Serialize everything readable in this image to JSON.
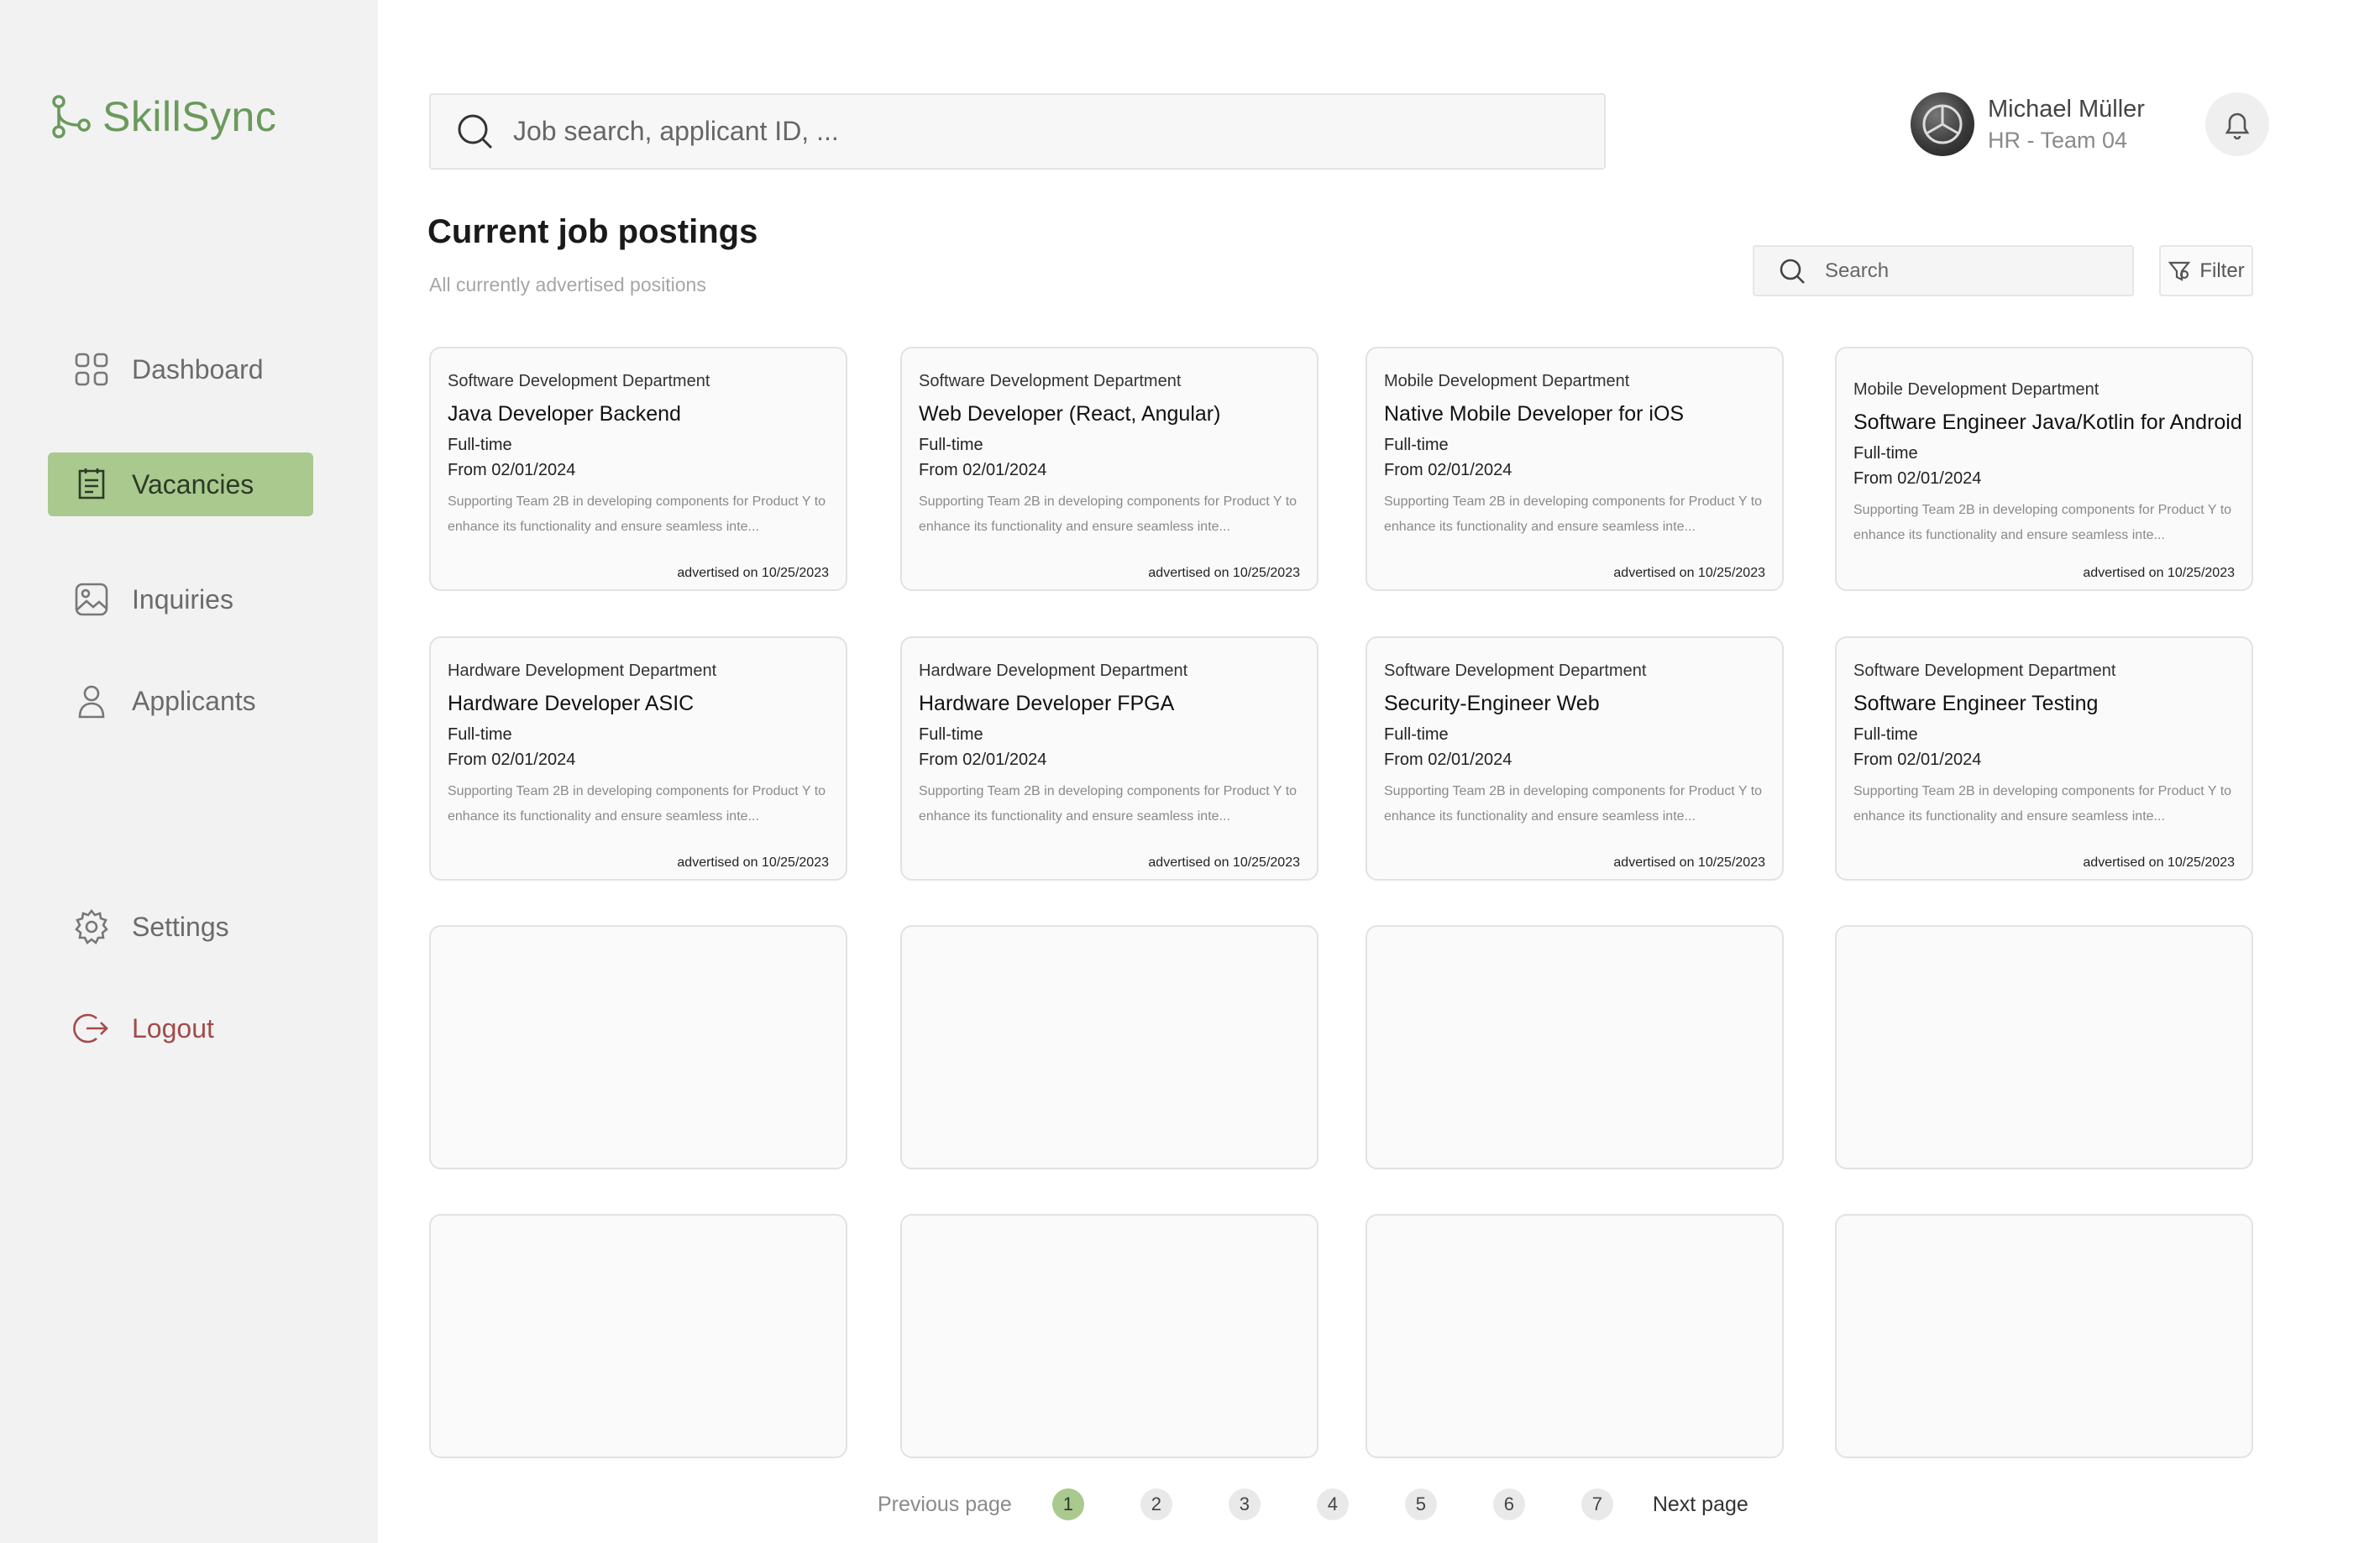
{
  "app": {
    "name": "SkillSync",
    "brand_color": "#6a9a5b",
    "accent_color": "#a9c98f",
    "logout_color": "#a34a4a"
  },
  "sidebar": {
    "items": [
      {
        "label": "Dashboard",
        "icon": "grid-icon"
      },
      {
        "label": "Vacancies",
        "icon": "clipboard-list-icon",
        "active": true
      },
      {
        "label": "Inquiries",
        "icon": "image-icon"
      },
      {
        "label": "Applicants",
        "icon": "user-icon"
      }
    ],
    "settings_label": "Settings",
    "logout_label": "Logout"
  },
  "header": {
    "search_placeholder": "Job search, applicant ID, ...",
    "user": {
      "name": "Michael Müller",
      "role": "HR - Team 04"
    }
  },
  "main": {
    "title": "Current job postings",
    "subtitle": "All currently advertised positions",
    "search_placeholder": "Search",
    "filter_label": "Filter"
  },
  "jobs": [
    {
      "department": "Software Development Department",
      "title": "Java Developer Backend",
      "type": "Full-time",
      "start": "From 02/01/2024",
      "description": "Supporting Team 2B in developing components for Product Y to enhance its functionality and ensure seamless inte...",
      "advertised": "advertised on 10/25/2023"
    },
    {
      "department": "Software Development Department",
      "title": "Web Developer (React, Angular)",
      "type": "Full-time",
      "start": "From 02/01/2024",
      "description": "Supporting Team 2B in developing components for Product Y to enhance its functionality and ensure seamless inte...",
      "advertised": "advertised on 10/25/2023"
    },
    {
      "department": "Mobile Development Department",
      "title": "Native Mobile Developer for iOS",
      "type": "Full-time",
      "start": "From 02/01/2024",
      "description": "Supporting Team 2B in developing components for Product Y to enhance its functionality and ensure seamless inte...",
      "advertised": "advertised on 10/25/2023"
    },
    {
      "department": "Mobile Development Department",
      "title": "Software Engineer Java/Kotlin for Android",
      "type": "Full-time",
      "start": "From 02/01/2024",
      "description": "Supporting Team 2B in developing components for Product Y to enhance its functionality and ensure seamless inte...",
      "advertised": "advertised on 10/25/2023"
    },
    {
      "department": "Hardware Development Department",
      "title": "Hardware Developer ASIC",
      "type": "Full-time",
      "start": "From 02/01/2024",
      "description": "Supporting Team 2B in developing components for Product Y to enhance its functionality and ensure seamless inte...",
      "advertised": "advertised on 10/25/2023"
    },
    {
      "department": "Hardware Development Department",
      "title": "Hardware Developer FPGA",
      "type": "Full-time",
      "start": "From 02/01/2024",
      "description": "Supporting Team 2B in developing components for Product Y to enhance its functionality and ensure seamless inte...",
      "advertised": "advertised on 10/25/2023"
    },
    {
      "department": "Software Development Department",
      "title": "Security-Engineer Web",
      "type": "Full-time",
      "start": "From 02/01/2024",
      "description": "Supporting Team 2B in developing components for Product Y to enhance its functionality and ensure seamless inte...",
      "advertised": "advertised on 10/25/2023"
    },
    {
      "department": "Software Development Department",
      "title": "Software Engineer Testing",
      "type": "Full-time",
      "start": "From 02/01/2024",
      "description": "Supporting Team 2B in developing components for Product Y to enhance its functionality and ensure seamless inte...",
      "advertised": "advertised on 10/25/2023"
    }
  ],
  "pagination": {
    "prev_label": "Previous page",
    "next_label": "Next page",
    "pages": [
      "1",
      "2",
      "3",
      "4",
      "5",
      "6",
      "7"
    ],
    "current": "1"
  }
}
